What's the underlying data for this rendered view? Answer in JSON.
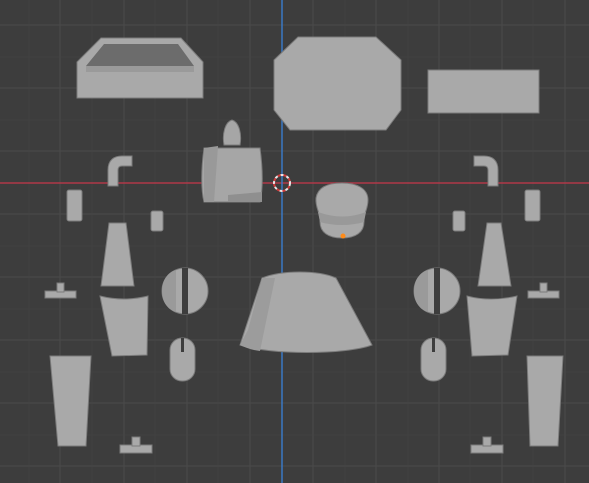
{
  "viewport": {
    "background": "#3d3d3d",
    "grid_color": "#4a4a4a",
    "x_axis_color": "#b03848",
    "y_axis_color": "#3a78c4",
    "object_fill": "#a9a9a9",
    "object_shade": "#8f8f8f",
    "object_stroke": "#7c7c7c",
    "cursor_color_a": "#e8e8e8",
    "cursor_color_b": "#d23a3a",
    "origin_color": "#ff8c1a"
  },
  "objects": [
    "tray-box",
    "octagon-panel",
    "flat-plate",
    "torso-neck",
    "head",
    "skirt-cone",
    "left-elbow-pipe",
    "right-elbow-pipe",
    "left-small-cylinder",
    "right-small-cylinder",
    "left-tiny-cylinder",
    "right-tiny-cylinder",
    "left-forearm-cone",
    "right-forearm-cone",
    "left-slotted-sphere",
    "right-slotted-sphere",
    "left-thigh",
    "right-thigh",
    "left-capsule",
    "right-capsule",
    "left-shin",
    "right-shin",
    "left-peg-upper",
    "right-peg-upper",
    "left-peg-lower",
    "right-peg-lower"
  ]
}
